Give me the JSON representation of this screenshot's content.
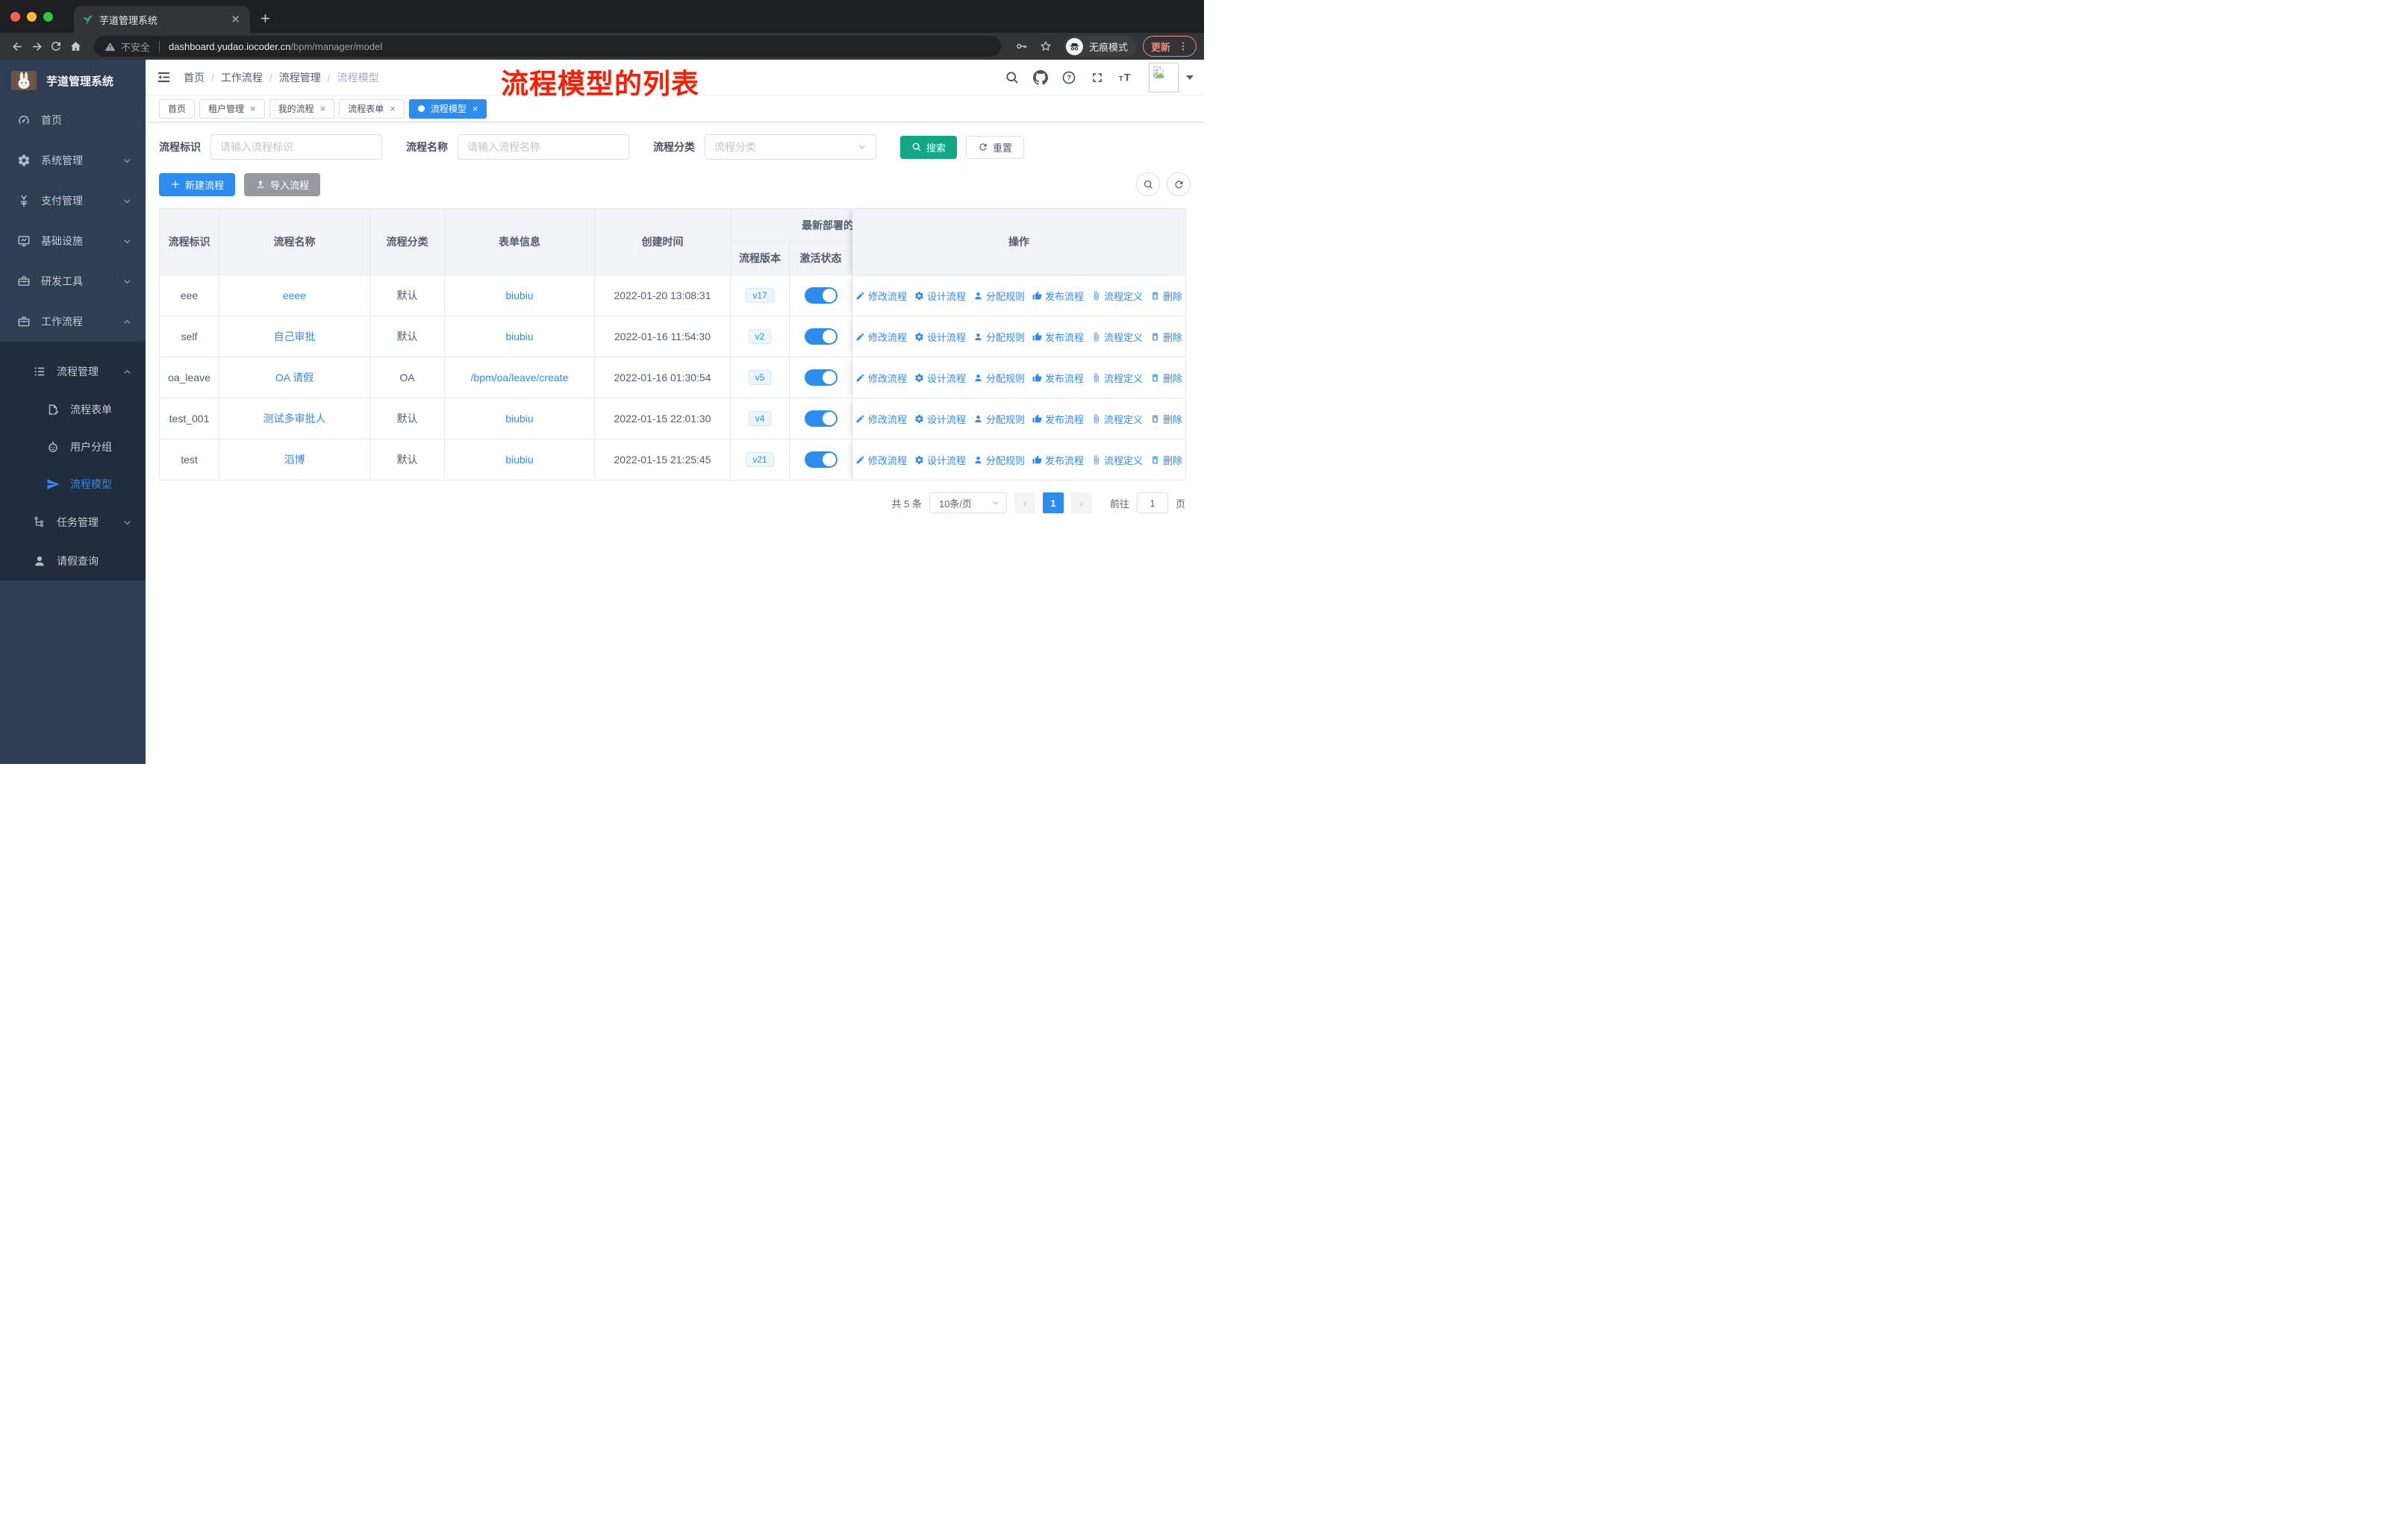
{
  "browser": {
    "tab_title": "芋道管理系统",
    "security_label": "不安全",
    "url_host": "dashboard.yudao.iocoder.cn",
    "url_path": "/bpm/manager/model",
    "incognito_label": "无痕模式",
    "update_label": "更新"
  },
  "sidebar": {
    "logo_title": "芋道管理系统",
    "items": [
      {
        "label": "首页",
        "icon": "dashboard-icon",
        "level": 1,
        "chevron": null,
        "dark": false,
        "active": false
      },
      {
        "label": "系统管理",
        "icon": "gear-icon",
        "level": 1,
        "chevron": "down",
        "dark": false,
        "active": false
      },
      {
        "label": "支付管理",
        "icon": "yen-icon",
        "level": 1,
        "chevron": "down",
        "dark": false,
        "active": false
      },
      {
        "label": "基础设施",
        "icon": "monitor-icon",
        "level": 1,
        "chevron": "down",
        "dark": false,
        "active": false
      },
      {
        "label": "研发工具",
        "icon": "toolbox-icon",
        "level": 1,
        "chevron": "down",
        "dark": false,
        "active": false
      },
      {
        "label": "工作流程",
        "icon": "suitcase-icon",
        "level": 1,
        "chevron": "up",
        "dark": false,
        "active": false
      },
      {
        "label": "流程管理",
        "icon": "list-icon",
        "level": 2,
        "chevron": "up",
        "dark": true,
        "active": false
      },
      {
        "label": "流程表单",
        "icon": "form-icon",
        "level": 3,
        "chevron": null,
        "dark": true,
        "active": false
      },
      {
        "label": "用户分组",
        "icon": "robot-icon",
        "level": 3,
        "chevron": null,
        "dark": true,
        "active": false
      },
      {
        "label": "流程模型",
        "icon": "plane-icon",
        "level": 3,
        "chevron": null,
        "dark": true,
        "active": true
      },
      {
        "label": "任务管理",
        "icon": "tree-icon",
        "level": 2,
        "chevron": "down",
        "dark": true,
        "active": false
      },
      {
        "label": "请假查询",
        "icon": "user-icon",
        "level": 2,
        "chevron": null,
        "dark": true,
        "active": false
      }
    ]
  },
  "header": {
    "breadcrumb": [
      "首页",
      "工作流程",
      "流程管理",
      "流程模型"
    ],
    "annotation": "流程模型的列表",
    "icons": [
      "search-icon",
      "github-icon",
      "question-icon",
      "fullscreen-icon",
      "fontsize-icon"
    ]
  },
  "tags": [
    {
      "label": "首页",
      "closable": false,
      "active": false
    },
    {
      "label": "租户管理",
      "closable": true,
      "active": false
    },
    {
      "label": "我的流程",
      "closable": true,
      "active": false
    },
    {
      "label": "流程表单",
      "closable": true,
      "active": false
    },
    {
      "label": "流程模型",
      "closable": true,
      "active": true
    }
  ],
  "filters": {
    "fields": [
      {
        "label": "流程标识",
        "placeholder": "请输入流程标识",
        "type": "input"
      },
      {
        "label": "流程名称",
        "placeholder": "请输入流程名称",
        "type": "input"
      },
      {
        "label": "流程分类",
        "placeholder": "流程分类",
        "type": "select"
      }
    ],
    "search_label": "搜索",
    "reset_label": "重置"
  },
  "toolbar": {
    "create_label": "新建流程",
    "create_icon": "plus-icon",
    "import_label": "导入流程",
    "import_icon": "upload-icon"
  },
  "table": {
    "columns": [
      "流程标识",
      "流程名称",
      "流程分类",
      "表单信息",
      "创建时间",
      "流程版本",
      "激活状态",
      "操作"
    ],
    "group_header": "最新部署的",
    "rows": [
      {
        "key": "eee",
        "name": "eeee",
        "category": "默认",
        "form": "biubiu",
        "created": "2022-01-20 13:08:31",
        "version": "v17",
        "active": true
      },
      {
        "key": "self",
        "name": "自己审批",
        "category": "默认",
        "form": "biubiu",
        "created": "2022-01-16 11:54:30",
        "version": "v2",
        "active": true
      },
      {
        "key": "oa_leave",
        "name": "OA 请假",
        "category": "OA",
        "form": "/bpm/oa/leave/create",
        "created": "2022-01-16 01:30:54",
        "version": "v5",
        "active": true
      },
      {
        "key": "test_001",
        "name": "测试多审批人",
        "category": "默认",
        "form": "biubiu",
        "created": "2022-01-15 22:01:30",
        "version": "v4",
        "active": true
      },
      {
        "key": "test",
        "name": "滔博",
        "category": "默认",
        "form": "biubiu",
        "created": "2022-01-15 21:25:45",
        "version": "v21",
        "active": true
      }
    ],
    "actions": [
      {
        "label": "修改流程",
        "icon": "edit-icon"
      },
      {
        "label": "设计流程",
        "icon": "gear-icon"
      },
      {
        "label": "分配规则",
        "icon": "person-icon"
      },
      {
        "label": "发布流程",
        "icon": "publish-icon"
      },
      {
        "label": "流程定义",
        "icon": "paperclip-icon"
      },
      {
        "label": "删除",
        "icon": "trash-icon"
      }
    ]
  },
  "pagination": {
    "total_label": "共 5 条",
    "page_size": "10条/页",
    "prev": "‹",
    "current_page": "1",
    "next": "›",
    "goto_label": "前往",
    "goto_value": "1",
    "page_label": "页"
  },
  "colors": {
    "primary": "#2d8cf0",
    "search_teal": "#11a983",
    "sidebar_bg": "#2f3e52",
    "sidebar_submenu_bg": "#212c3c",
    "annotation_red": "#fe1b00"
  }
}
